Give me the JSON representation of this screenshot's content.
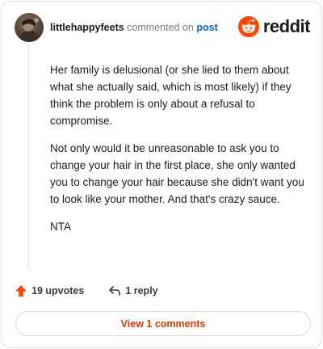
{
  "comment": {
    "username": "littlehappyfeets",
    "action_text": "commented on",
    "post_link": "post",
    "paragraphs": [
      "Her family is delusional (or she lied to them about what she actually said, which is most likely) if they think the problem is only about a refusal to compromise.",
      "Not only would it be unreasonable to ask you to change your hair in the first place, she only wanted you to change your hair because she didn't want you to look like your mother. And that's crazy sauce.",
      "NTA"
    ]
  },
  "brand": {
    "name": "reddit",
    "icon": "reddit-snoo-icon",
    "color": "#ff4500"
  },
  "actions": {
    "upvotes_label": "19 upvotes",
    "reply_label": "1 reply",
    "upvote_icon": "upvote-arrow-icon",
    "reply_icon": "reply-arrow-icon"
  },
  "footer": {
    "view_comments_label": "View 1 comments"
  },
  "colors": {
    "accent": "#ff4500",
    "link": "#0a66c2",
    "view_button_text": "#d93a00"
  }
}
